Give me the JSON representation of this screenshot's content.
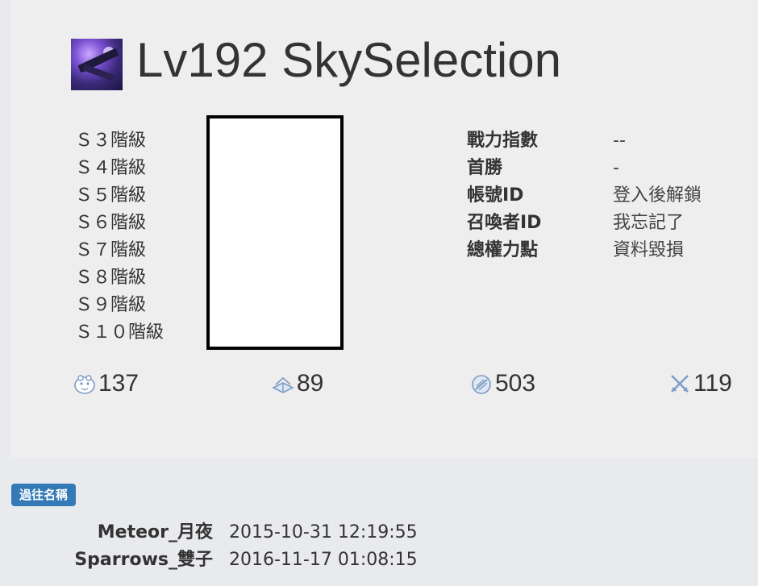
{
  "summoner": {
    "title": "Lv192 SkySelection",
    "avatar_icon": "assassin-champion-icon"
  },
  "ranks": [
    "Ｓ３階級",
    "Ｓ４階級",
    "Ｓ５階級",
    "Ｓ６階級",
    "Ｓ７階級",
    "Ｓ８階級",
    "Ｓ９階級",
    "Ｓ１０階級"
  ],
  "info": [
    {
      "label": "戰力指數",
      "value": "--"
    },
    {
      "label": "首勝",
      "value": "-"
    },
    {
      "label": "帳號ID",
      "value": "登入後解鎖"
    },
    {
      "label": "召喚者ID",
      "value": "我忘記了"
    },
    {
      "label": "總權力點",
      "value": "資料毀損"
    }
  ],
  "stats": [
    {
      "icon": "poro-icon",
      "value": "137"
    },
    {
      "icon": "book-icon",
      "value": "89"
    },
    {
      "icon": "shield-icon",
      "value": "503"
    },
    {
      "icon": "crossed-swords-icon",
      "value": "119"
    }
  ],
  "past_names": {
    "badge": "過往名稱",
    "entries": [
      {
        "name": "Meteor_月夜",
        "date": "2015-10-31 12:19:55"
      },
      {
        "name": "Sparrows_雙子",
        "date": "2016-11-17 01:08:15"
      }
    ]
  },
  "colors": {
    "badge": "#337ab7",
    "card": "#eeeeee",
    "page": "#e9eaed",
    "icon": "#7a9bc4"
  }
}
